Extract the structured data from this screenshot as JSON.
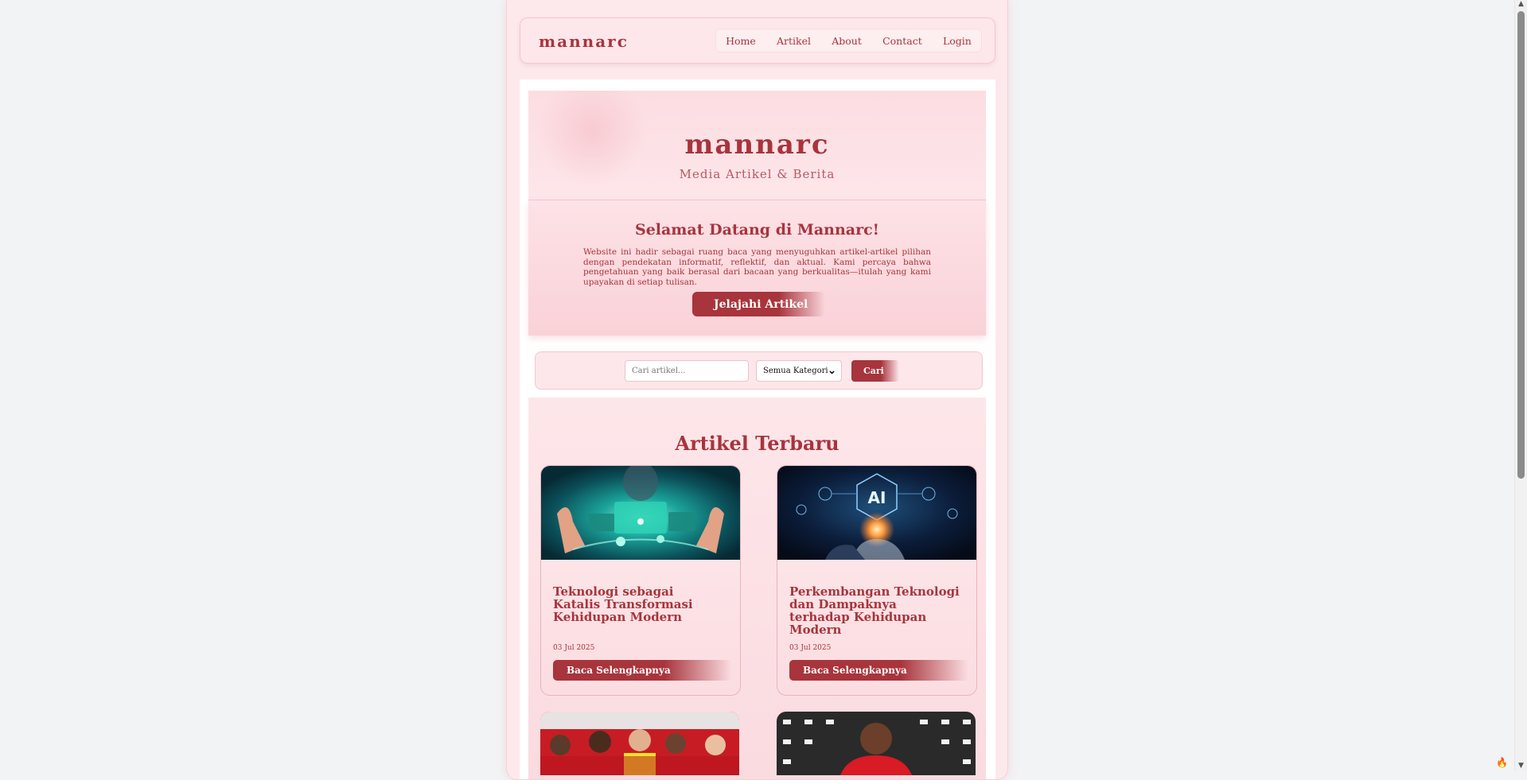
{
  "site": {
    "brand": "mannarc",
    "nav": [
      "Home",
      "Artikel",
      "About",
      "Contact",
      "Login"
    ]
  },
  "hero": {
    "title": "mannarc",
    "subtitle": "Media Artikel & Berita"
  },
  "welcome": {
    "title": "Selamat Datang di Mannarc!",
    "text": "Website ini hadir sebagai ruang baca yang menyuguhkan artikel-artikel pilihan dengan pendekatan informatif, reflektif, dan aktual. Kami percaya bahwa pengetahuan yang baik berasal dari bacaan yang berkualitas—itulah yang kami upayakan di setiap tulisan.",
    "cta_label": "Jelajahi Artikel"
  },
  "search": {
    "placeholder": "Cari artikel...",
    "category_selected": "Semua Kategori",
    "button_label": "Cari"
  },
  "articles": {
    "section_title": "Artikel Terbaru",
    "items": [
      {
        "title": "Teknologi sebagai Katalis Transformasi Kehidupan Modern",
        "date": "03 Jul 2025",
        "button_label": "Baca Selengkapnya"
      },
      {
        "title": "Perkembangan Teknologi dan Dampaknya terhadap Kehidupan Modern",
        "date": "03 Jul 2025",
        "button_label": "Baca Selengkapnya"
      }
    ],
    "card2_image_text": "AI"
  },
  "colors": {
    "accent": "#a8343c",
    "page_bg": "#fde9ec",
    "outer_bg": "#f2f3f5"
  }
}
